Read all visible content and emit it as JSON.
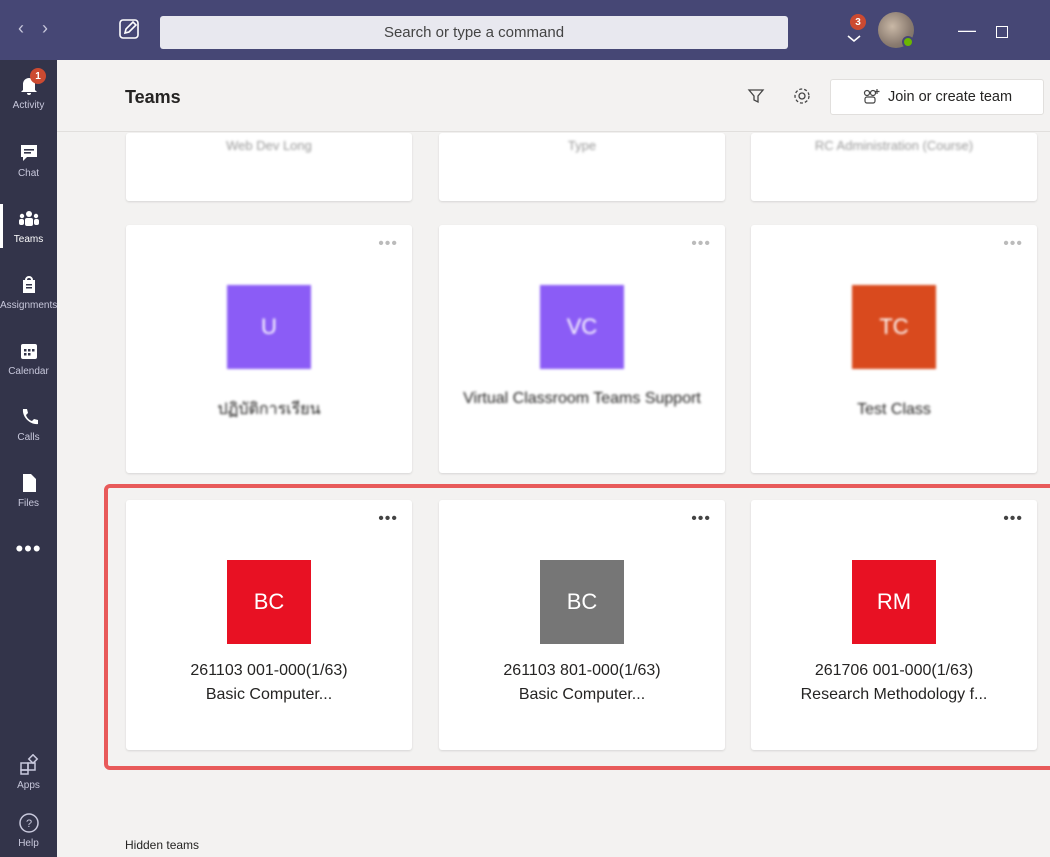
{
  "titlebar": {
    "search_placeholder": "Search or type a command",
    "notification_count": "3"
  },
  "rail": {
    "activity_badge": "1",
    "items": [
      {
        "label": "Activity"
      },
      {
        "label": "Chat"
      },
      {
        "label": "Teams"
      },
      {
        "label": "Assignments"
      },
      {
        "label": "Calendar"
      },
      {
        "label": "Calls"
      },
      {
        "label": "Files"
      }
    ],
    "more": "•••",
    "apps": "Apps",
    "help": "Help"
  },
  "header": {
    "title": "Teams",
    "join_label": "Join or create team"
  },
  "partial_row": [
    {
      "name": "Web Dev Long"
    },
    {
      "name": "Type"
    },
    {
      "name": "RC Administration (Course)"
    }
  ],
  "row2": [
    {
      "initials": "U",
      "name": "ปฏิบัติการเรียน",
      "color": "#8b5cf6"
    },
    {
      "initials": "VC",
      "name": "Virtual Classroom Teams Support",
      "color": "#8b5cf6"
    },
    {
      "initials": "TC",
      "name": "Test Class",
      "color": "#d94a1e"
    }
  ],
  "row3": [
    {
      "initials": "BC",
      "line1": "261103 001-000(1/63)",
      "line2": "Basic Computer...",
      "color": "#e81123"
    },
    {
      "initials": "BC",
      "line1": "261103 801-000(1/63)",
      "line2": "Basic Computer...",
      "color": "#767676"
    },
    {
      "initials": "RM",
      "line1": "261706 001-000(1/63)",
      "line2": "Research Methodology f...",
      "color": "#e81123"
    }
  ],
  "footer": {
    "hidden_teams": "Hidden teams"
  },
  "more_dots": "•••"
}
